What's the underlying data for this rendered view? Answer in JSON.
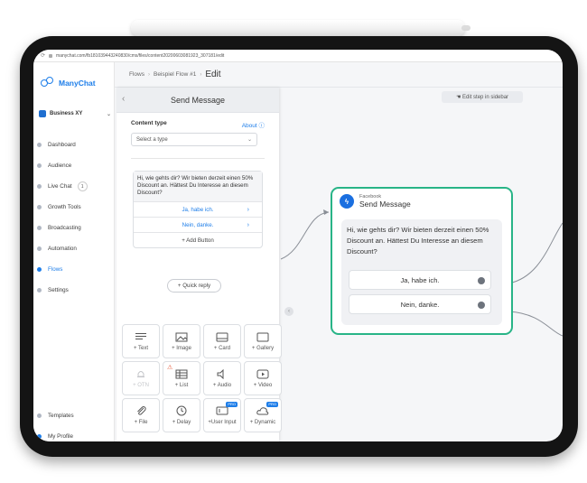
{
  "browser": {
    "url": "manychat.com/fb181039443240830/cms/files/content20200603081923_307181/edit"
  },
  "sidebar": {
    "brand": "ManyChat",
    "account": "Business XY",
    "items": [
      {
        "label": "Dashboard"
      },
      {
        "label": "Audience"
      },
      {
        "label": "Live Chat",
        "badge": "1"
      },
      {
        "label": "Growth Tools"
      },
      {
        "label": "Broadcasting"
      },
      {
        "label": "Automation"
      },
      {
        "label": "Flows",
        "active": true
      },
      {
        "label": "Settings"
      }
    ],
    "bottom_items": [
      {
        "label": "Templates"
      },
      {
        "label": "My Profile"
      }
    ]
  },
  "header": {
    "crumb1": "Flows",
    "crumb2": "Beispiel Flow #1",
    "current": "Edit"
  },
  "panel": {
    "title": "Send Message",
    "content_type_label": "Content type",
    "about_label": "About",
    "select_placeholder": "Select a type",
    "message_text": "Hi, wie gehts dir? Wir bieten derzeit einen 50% Discount an. Hättest Du Interesse an diesem Discount?",
    "buttons": [
      "Ja, habe ich.",
      "Nein, danke."
    ],
    "add_button": "+ Add Button",
    "quick_reply": "+ Quick reply",
    "tiles": [
      {
        "label": "+ Text",
        "icon": "text-icon"
      },
      {
        "label": "+ Image",
        "icon": "image-icon"
      },
      {
        "label": "+ Card",
        "icon": "card-icon"
      },
      {
        "label": "+ Gallery",
        "icon": "gallery-icon"
      },
      {
        "label": "+ OTN",
        "icon": "bell-icon",
        "disabled": true
      },
      {
        "label": "+ List",
        "icon": "list-icon",
        "warning": true
      },
      {
        "label": "+ Audio",
        "icon": "audio-icon"
      },
      {
        "label": "+ Video",
        "icon": "video-icon"
      },
      {
        "label": "+ File",
        "icon": "file-icon"
      },
      {
        "label": "+ Delay",
        "icon": "clock-icon"
      },
      {
        "label": "+User Input",
        "icon": "input-icon",
        "pro": "PRO"
      },
      {
        "label": "+ Dynamic",
        "icon": "cloud-icon",
        "pro": "PRO"
      }
    ]
  },
  "canvas": {
    "sidebar_hint": "Edit step in sidebar",
    "node": {
      "channel": "Facebook",
      "title": "Send Message",
      "text": "Hi, wie gehts dir? Wir bieten derzeit einen 50% Discount an. Hättest Du Interesse an diesem Discount?",
      "buttons": [
        "Ja, habe ich.",
        "Nein, danke."
      ]
    }
  },
  "colors": {
    "accent": "#1e7ee9",
    "node_border": "#28b487",
    "facebook": "#1a6fe0"
  }
}
